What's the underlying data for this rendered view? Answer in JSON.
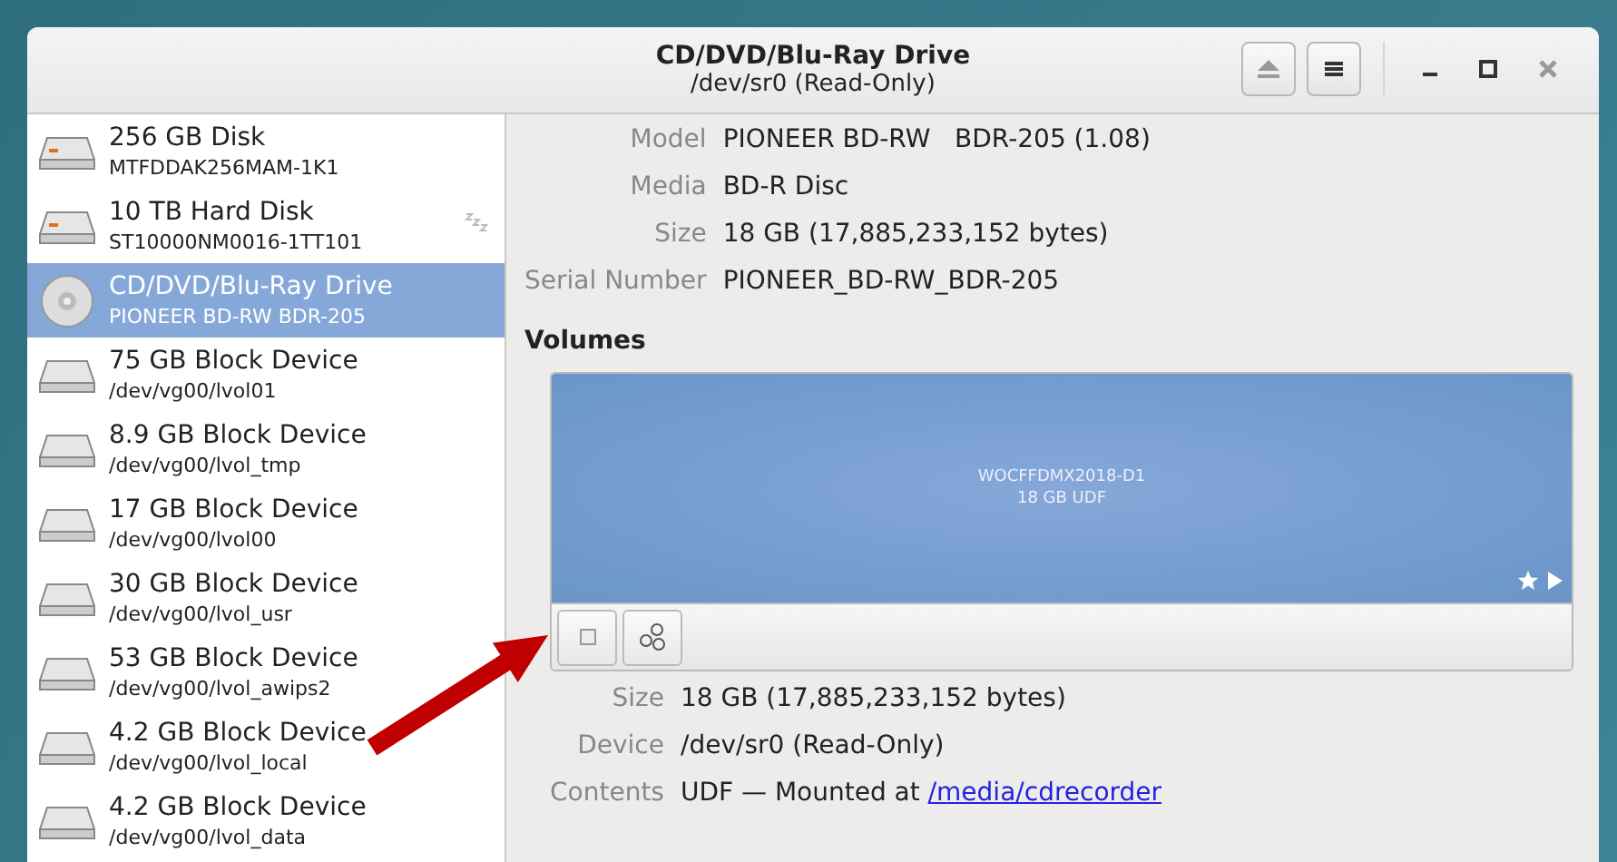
{
  "window": {
    "title": "CD/DVD/Blu-Ray Drive",
    "subtitle": "/dev/sr0 (Read-Only)"
  },
  "sidebar": {
    "items": [
      {
        "kind": "disk",
        "name": "256 GB Disk",
        "detail": "MTFDDAK256MAM-1K1",
        "sleeping": false,
        "selected": false
      },
      {
        "kind": "disk",
        "name": "10 TB Hard Disk",
        "detail": "ST10000NM0016-1TT101",
        "sleeping": true,
        "selected": false
      },
      {
        "kind": "optical",
        "name": "CD/DVD/Blu-Ray Drive",
        "detail": "PIONEER BD-RW   BDR-205",
        "sleeping": false,
        "selected": true
      },
      {
        "kind": "block",
        "name": "75 GB Block Device",
        "detail": "/dev/vg00/lvol01",
        "sleeping": false,
        "selected": false
      },
      {
        "kind": "block",
        "name": "8.9 GB Block Device",
        "detail": "/dev/vg00/lvol_tmp",
        "sleeping": false,
        "selected": false
      },
      {
        "kind": "block",
        "name": "17 GB Block Device",
        "detail": "/dev/vg00/lvol00",
        "sleeping": false,
        "selected": false
      },
      {
        "kind": "block",
        "name": "30 GB Block Device",
        "detail": "/dev/vg00/lvol_usr",
        "sleeping": false,
        "selected": false
      },
      {
        "kind": "block",
        "name": "53 GB Block Device",
        "detail": "/dev/vg00/lvol_awips2",
        "sleeping": false,
        "selected": false
      },
      {
        "kind": "block",
        "name": "4.2 GB Block Device",
        "detail": "/dev/vg00/lvol_local",
        "sleeping": false,
        "selected": false
      },
      {
        "kind": "block",
        "name": "4.2 GB Block Device",
        "detail": "/dev/vg00/lvol_data",
        "sleeping": false,
        "selected": false
      }
    ]
  },
  "drive": [
    {
      "label": "Model",
      "value": "PIONEER BD-RW   BDR-205 (1.08)"
    },
    {
      "label": "Media",
      "value": "BD-R Disc"
    },
    {
      "label": "Size",
      "value": "18 GB (17,885,233,152 bytes)"
    },
    {
      "label": "Serial Number",
      "value": "PIONEER_BD-RW_BDR-205"
    }
  ],
  "volumes": {
    "heading": "Volumes",
    "volume_name": "WOCFFDMX2018-D1",
    "volume_info": "18 GB UDF",
    "details": [
      {
        "label": "Size",
        "value": "18 GB (17,885,233,152 bytes)"
      },
      {
        "label": "Device",
        "value": "/dev/sr0 (Read-Only)"
      },
      {
        "label": "Contents",
        "value": "UDF — Mounted at ",
        "link": "/media/cdrecorder"
      }
    ]
  }
}
